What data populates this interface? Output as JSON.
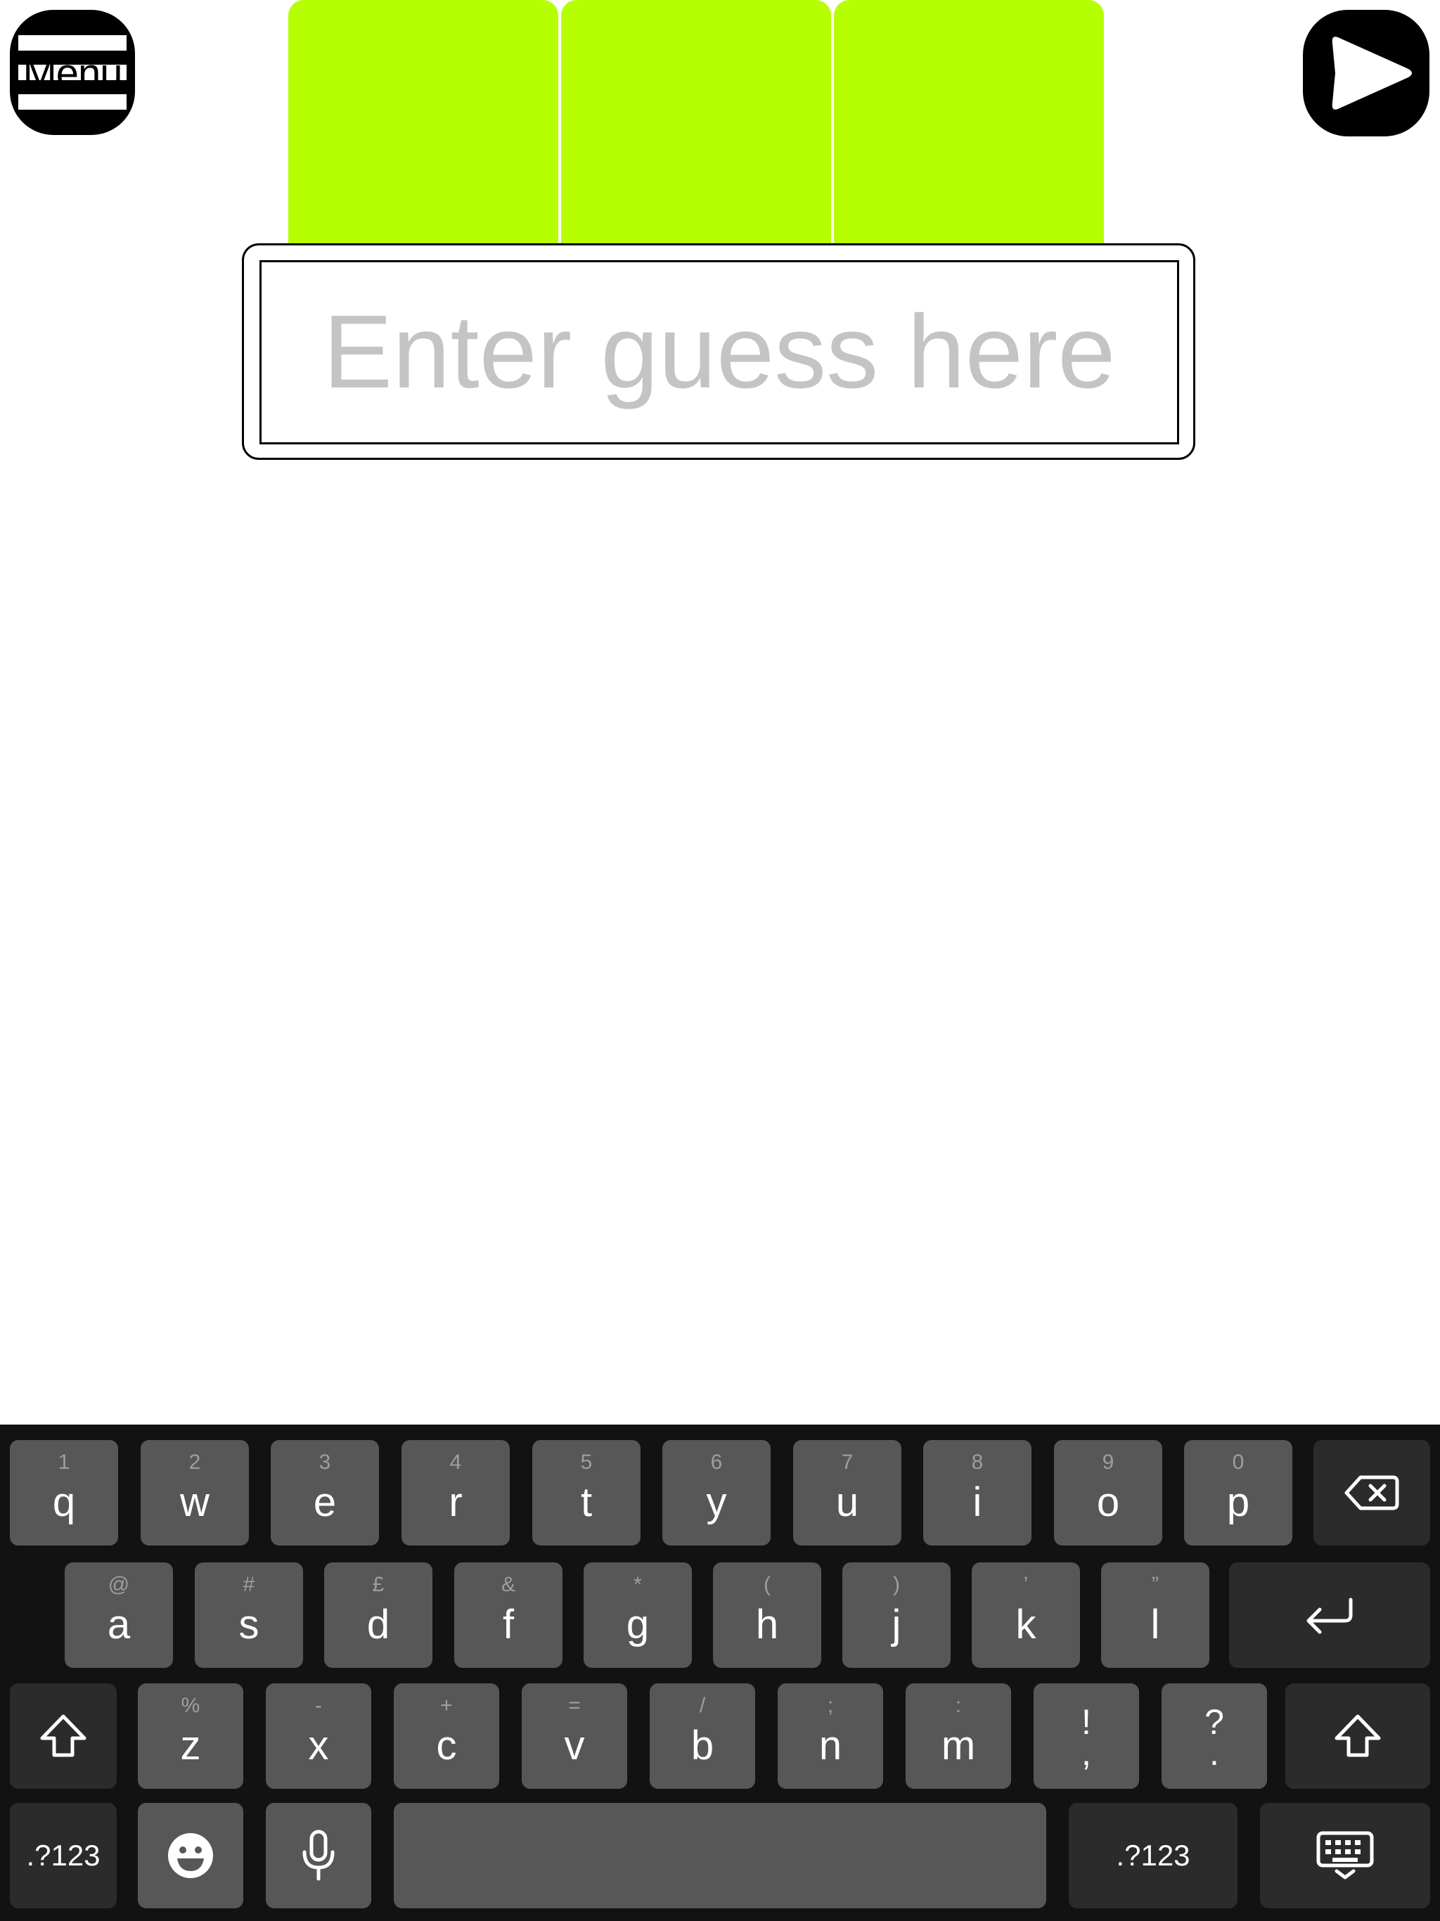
{
  "app": {
    "menu_label": "Menu",
    "accent_color": "#b6ff00"
  },
  "guess": {
    "placeholder": "Enter guess here",
    "value": ""
  },
  "keyboard": {
    "row1": [
      {
        "sub": "1",
        "main": "q"
      },
      {
        "sub": "2",
        "main": "w"
      },
      {
        "sub": "3",
        "main": "e"
      },
      {
        "sub": "4",
        "main": "r"
      },
      {
        "sub": "5",
        "main": "t"
      },
      {
        "sub": "6",
        "main": "y"
      },
      {
        "sub": "7",
        "main": "u"
      },
      {
        "sub": "8",
        "main": "i"
      },
      {
        "sub": "9",
        "main": "o"
      },
      {
        "sub": "0",
        "main": "p"
      }
    ],
    "row2": [
      {
        "sub": "@",
        "main": "a"
      },
      {
        "sub": "#",
        "main": "s"
      },
      {
        "sub": "£",
        "main": "d"
      },
      {
        "sub": "&",
        "main": "f"
      },
      {
        "sub": "*",
        "main": "g"
      },
      {
        "sub": "(",
        "main": "h"
      },
      {
        "sub": ")",
        "main": "j"
      },
      {
        "sub": "’",
        "main": "k"
      },
      {
        "sub": "”",
        "main": "l"
      }
    ],
    "row3": [
      {
        "sub": "%",
        "main": "z"
      },
      {
        "sub": "-",
        "main": "x"
      },
      {
        "sub": "+",
        "main": "c"
      },
      {
        "sub": "=",
        "main": "v"
      },
      {
        "sub": "/",
        "main": "b"
      },
      {
        "sub": ";",
        "main": "n"
      },
      {
        "sub": ":",
        "main": "m"
      }
    ],
    "punct": [
      {
        "top": "!",
        "bottom": ","
      },
      {
        "top": "?",
        "bottom": "."
      }
    ],
    "numbers_label": ".?123",
    "icons": {
      "backspace": "backspace-icon",
      "return": "return-icon",
      "shift": "shift-icon",
      "emoji": "emoji-icon",
      "mic": "microphone-icon",
      "hide": "hide-keyboard-icon"
    }
  }
}
